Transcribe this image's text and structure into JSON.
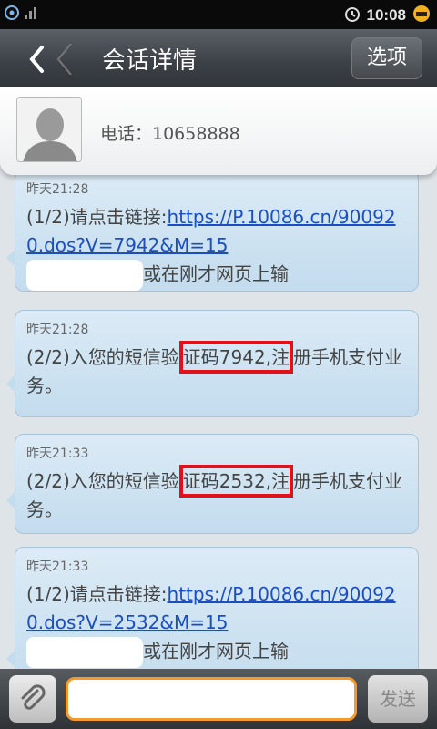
{
  "statusbar": {
    "time": "10:08",
    "signal_icon": "signal-icon",
    "notification_icon": "notification-icon"
  },
  "titlebar": {
    "back_icon": "back-chevron-icon",
    "title": "会话详情",
    "options_label": "选项"
  },
  "contact": {
    "phone_label": "电话：10658888",
    "avatar_icon": "person-silhouette-icon"
  },
  "messages": [
    {
      "time": "昨天21:28",
      "prefix": "(1/2)请点击链接:",
      "link": "https://P.10086.cn/900920.dos?V=7942&M=15",
      "suffix": "或在刚才网页上输"
    },
    {
      "time": "昨天21:28",
      "before": "(2/2)入您的短信验",
      "highlight": "证码7942,注",
      "after": "册手机支付业务。"
    },
    {
      "time": "昨天21:33",
      "before": "(2/2)入您的短信验",
      "highlight": "证码2532,注",
      "after": "册手机支付业务。"
    },
    {
      "time": "昨天21:33",
      "prefix": "(1/2)请点击链接:",
      "link": "https://P.10086.cn/900920.dos?V=2532&M=15",
      "suffix": "或在刚才网页上输"
    }
  ],
  "composer": {
    "placeholder": "",
    "send_label": "发送",
    "attach_icon": "paperclip-icon"
  },
  "colors": {
    "highlight": "#e1111a",
    "input_border": "#f39a2c",
    "link": "#1a4fc4"
  }
}
